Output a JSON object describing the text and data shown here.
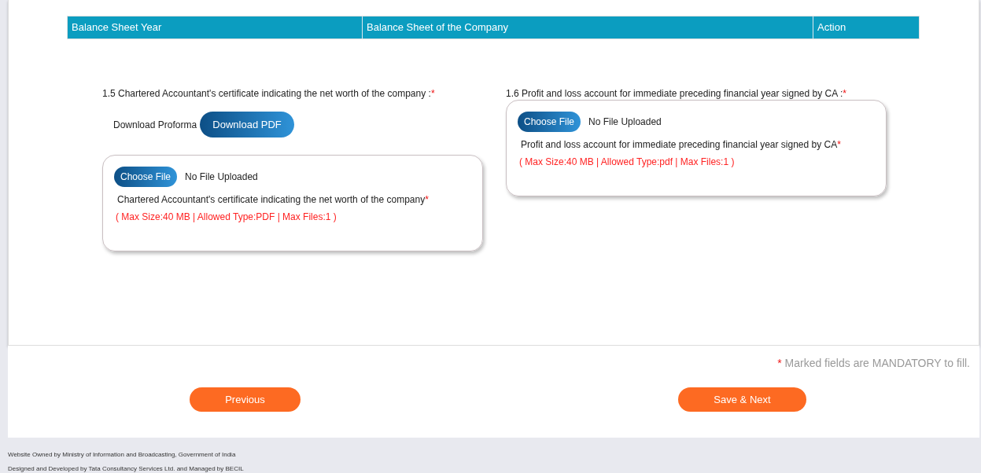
{
  "table": {
    "columns": [
      "Balance Sheet Year",
      "Balance Sheet of the Company",
      "Action"
    ]
  },
  "sections": [
    {
      "label": "1.5 Chartered Accountant's certificate indicating the net worth of the company :",
      "mark": "*",
      "proforma": {
        "label": "Download Proforma",
        "button": "Download PDF"
      },
      "upload": {
        "button": "Choose File",
        "status": "No File Uploaded",
        "description": "Chartered Accountant's certificate indicating the net worth of the company",
        "mark": "*",
        "limits": "( Max Size:40 MB | Allowed Type:PDF | Max Files:1 )"
      }
    },
    {
      "label": "1.6 Profit and loss account for immediate preceding financial year signed by CA :",
      "mark": "*",
      "upload": {
        "button": "Choose File",
        "status": "No File Uploaded",
        "description": "Profit and loss account for immediate preceding financial year signed by CA",
        "mark": "*",
        "limits": "( Max Size:40 MB | Allowed Type:pdf | Max Files:1 )"
      }
    }
  ],
  "mandatory_note": {
    "mark": "*",
    "text": "Marked fields are MANDATORY to fill."
  },
  "buttons": [
    "Previous",
    "Save & Next"
  ],
  "footer": [
    "Website Owned by Ministry of Information and Broadcasting, Government of India",
    "Designed and Developed by Tata Consultancy Services Ltd. and Managed by BECIL"
  ]
}
